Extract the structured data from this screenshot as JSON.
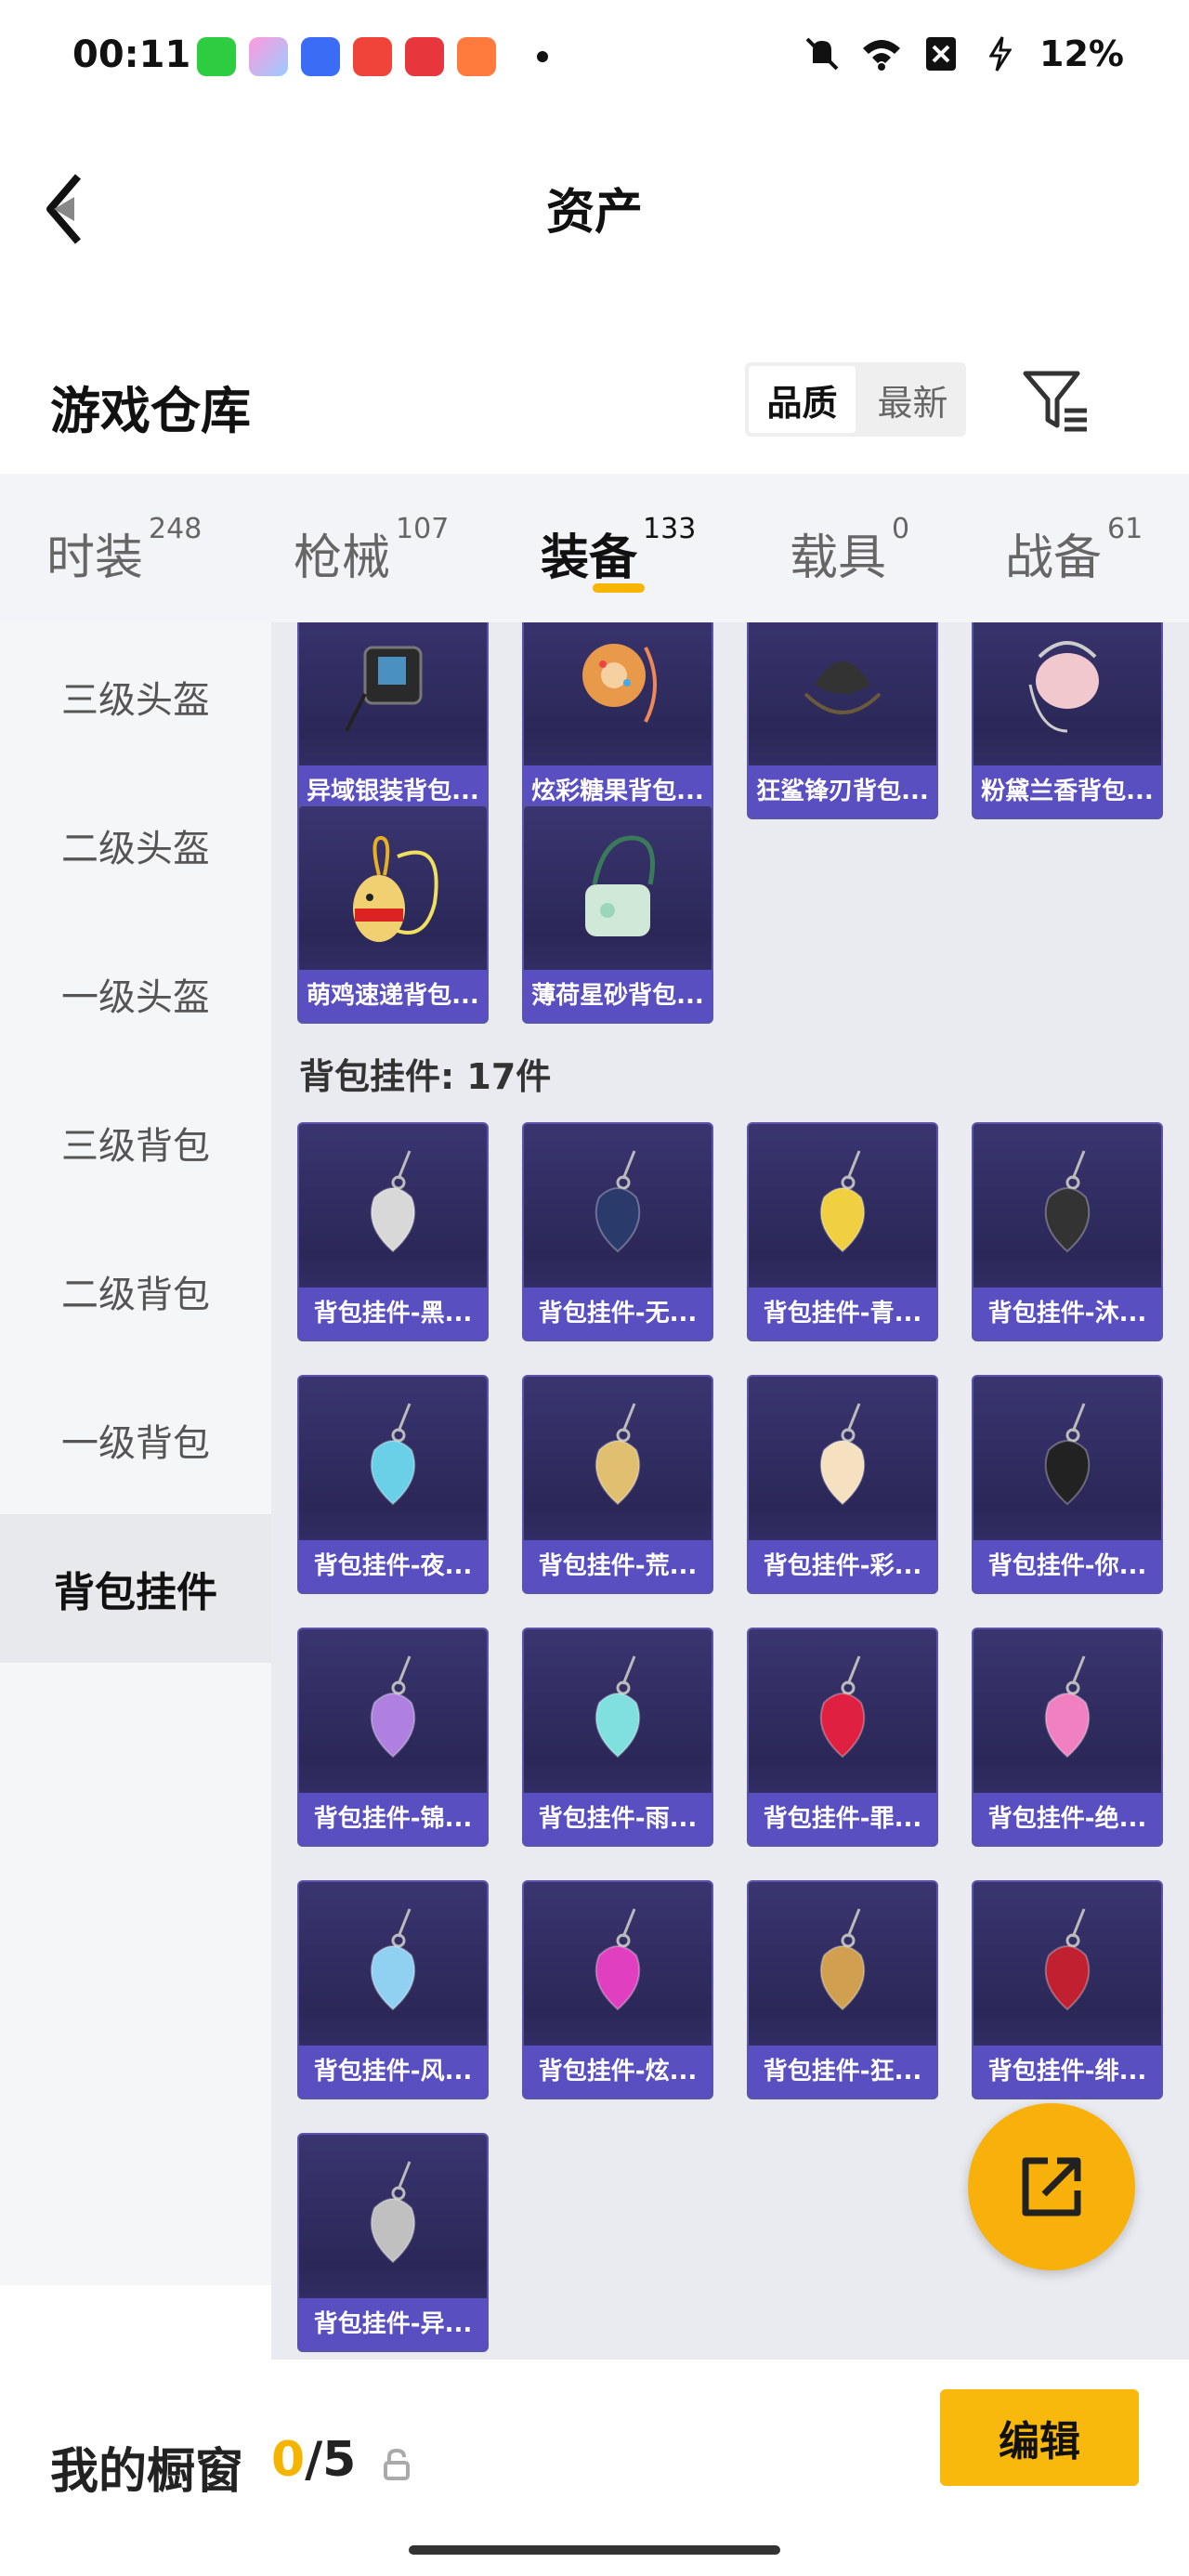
{
  "status": {
    "time": "00:11",
    "battery": "12%"
  },
  "nav": {
    "title": "资产"
  },
  "header": {
    "title": "游戏仓库",
    "sort_options": [
      "品质",
      "最新"
    ]
  },
  "tabs": [
    {
      "label": "时装",
      "count": "248"
    },
    {
      "label": "枪械",
      "count": "107"
    },
    {
      "label": "装备",
      "count": "133"
    },
    {
      "label": "载具",
      "count": "0"
    },
    {
      "label": "战备",
      "count": "61"
    }
  ],
  "sidebar": [
    "三级头盔",
    "二级头盔",
    "一级头盔",
    "三级背包",
    "二级背包",
    "一级背包",
    "背包挂件"
  ],
  "backpacks_top_row": [
    "异域银装背包...",
    "炫彩糖果背包...",
    "狂鲨锋刃背包...",
    "粉黛兰香背包..."
  ],
  "backpacks_second_row": [
    "萌鸡速递背包...",
    "薄荷星砂背包..."
  ],
  "section": {
    "title": "背包挂件: 17件"
  },
  "pendants": [
    "背包挂件-黑...",
    "背包挂件-无...",
    "背包挂件-青...",
    "背包挂件-沐...",
    "背包挂件-夜...",
    "背包挂件-荒...",
    "背包挂件-彩...",
    "背包挂件-你...",
    "背包挂件-锦...",
    "背包挂件-雨...",
    "背包挂件-罪...",
    "背包挂件-绝...",
    "背包挂件-风...",
    "背包挂件-炫...",
    "背包挂件-狂...",
    "背包挂件-绯...",
    "背包挂件-异..."
  ],
  "bottom": {
    "label": "我的橱窗",
    "current": "0",
    "total": "/5",
    "edit": "编辑"
  }
}
